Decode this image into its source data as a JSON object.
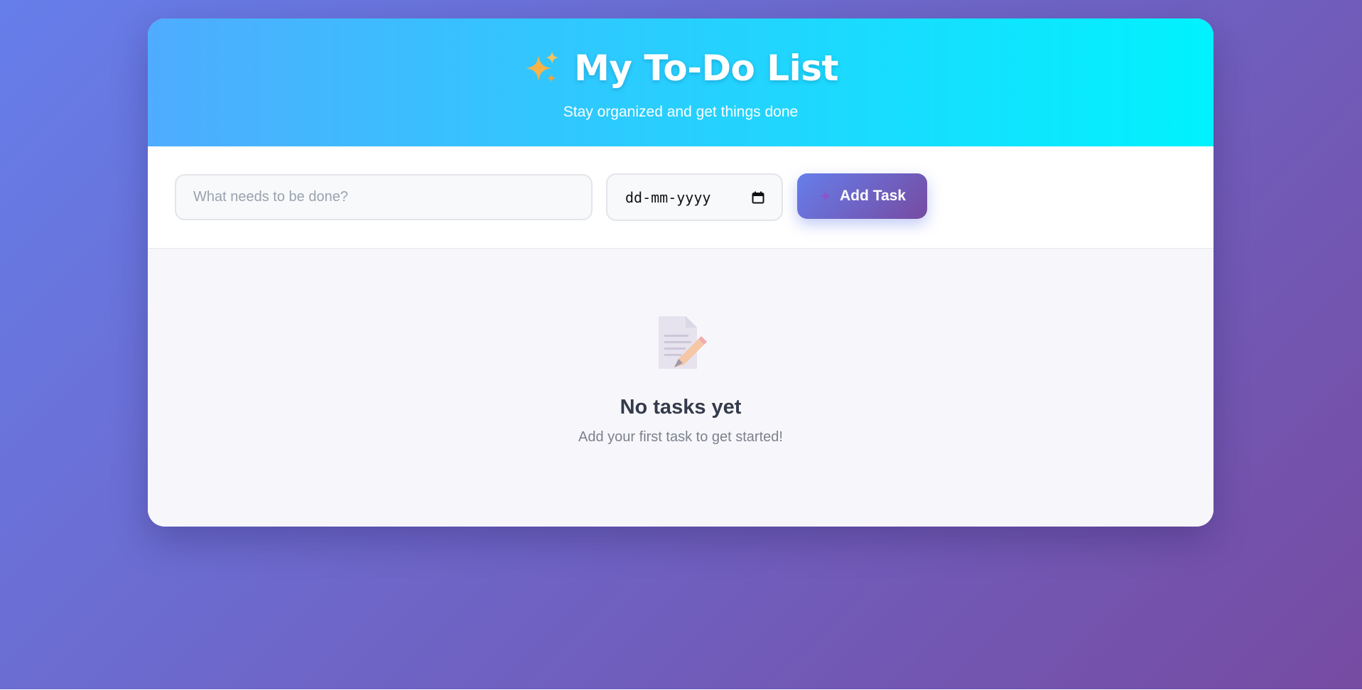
{
  "header": {
    "title": "My To-Do List",
    "subtitle": "Stay organized and get things done",
    "title_icon": "sparkles-icon"
  },
  "form": {
    "task_placeholder": "What needs to be done?",
    "task_value": "",
    "date_placeholder": "dd-mm-yyyy",
    "date_icon": "calendar-icon",
    "add_button_label": "Add Task",
    "add_button_icon": "plus-icon"
  },
  "empty_state": {
    "icon": "memo-icon",
    "title": "No tasks yet",
    "message": "Add your first task to get started!"
  },
  "colors": {
    "header_gradient_start": "#4facfe",
    "header_gradient_end": "#00f2fe",
    "background_gradient_start": "#667eea",
    "background_gradient_end": "#764ba2",
    "button_gradient_start": "#667eea",
    "button_gradient_end": "#764ba2"
  }
}
